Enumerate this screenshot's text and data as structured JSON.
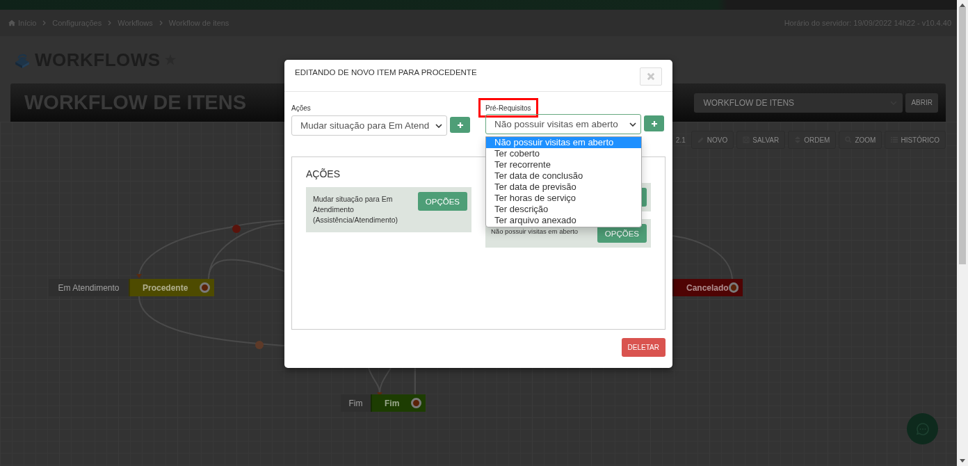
{
  "breadcrumb": [
    {
      "label": "Início",
      "kind": "home"
    },
    {
      "label": "Configurações",
      "kind": "link"
    },
    {
      "label": "Workflows",
      "kind": "link"
    },
    {
      "label": "Workflow de itens",
      "kind": "link"
    }
  ],
  "server_time": "Horário do servidor: 19/09/2022 14h22 - v10.4.40",
  "page_title": {
    "text": "WORKFLOWS",
    "favorite": false
  },
  "workflow_header": {
    "title": "WORKFLOW DE ITENS",
    "select_value": "WORKFLOW DE ITENS",
    "open_button": "ABRIR"
  },
  "toolbar": {
    "version": "2.1",
    "buttons": [
      {
        "label": "NOVO",
        "kind": "pencil"
      },
      {
        "label": "SALVAR",
        "kind": "save"
      },
      {
        "label": "ORDEM",
        "kind": "sort"
      },
      {
        "label": "ZOOM",
        "kind": "search"
      },
      {
        "label": "HISTÓRICO",
        "kind": "list"
      }
    ]
  },
  "diagram": {
    "nodes": [
      {
        "tag": "Em Atendimento",
        "label": "Procedente",
        "color": "#4e4b00"
      },
      {
        "label": "Cancelado",
        "color": "#4f0404"
      },
      {
        "tag": "Fim",
        "label": "Fim",
        "color": "#1d3d02"
      }
    ]
  },
  "modal": {
    "title": "EDITANDO DE NOVO ITEM PARA PROCEDENTE",
    "actions_field": {
      "label": "Ações",
      "value": "Mudar situação para Em Atend"
    },
    "prerequisites_field": {
      "label": "Pré-Requisitos",
      "highlighted": true,
      "value": "Não possuir visitas em aberto",
      "options": [
        {
          "label": "Não possuir visitas em aberto",
          "selected": true
        },
        {
          "label": "Ter coberto",
          "selected": false
        },
        {
          "label": "Ter recorrente",
          "selected": false
        },
        {
          "label": "Ter data de conclusão",
          "selected": false
        },
        {
          "label": "Ter data de previsão",
          "selected": false
        },
        {
          "label": "Ter horas de serviço",
          "selected": false
        },
        {
          "label": "Ter descrição",
          "selected": false
        },
        {
          "label": "Ter arquivo anexado",
          "selected": false
        }
      ]
    },
    "actions_panel": {
      "heading": "AÇÕES",
      "items": [
        {
          "text": "Mudar situação para Em Atendimento (Assistência/Atendimento)",
          "button": "OPÇÕES"
        }
      ]
    },
    "prerequisites_items": [
      {
        "kind": "covered"
      },
      {
        "kind": "card",
        "text": "Não possuir visitas em aberto",
        "button": "OPÇÕES"
      }
    ],
    "delete_button": "DELETAR"
  }
}
